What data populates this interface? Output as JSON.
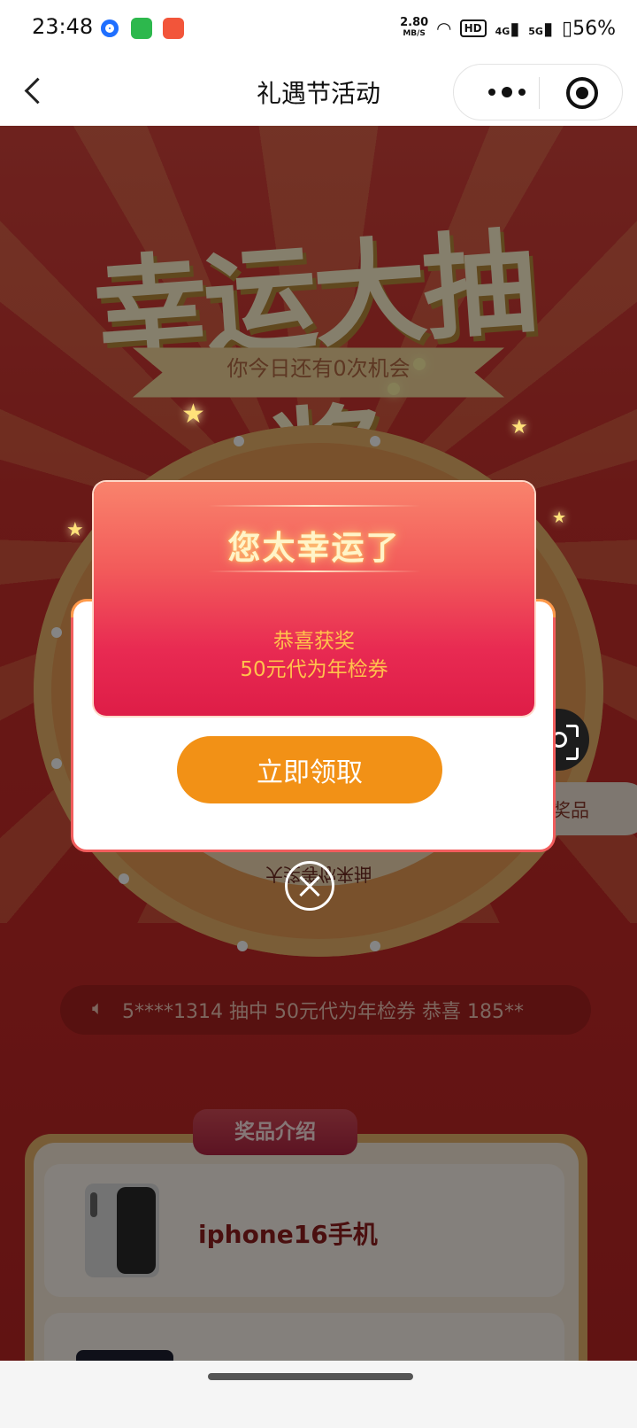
{
  "status_bar": {
    "time": "23:48",
    "net_speed_value": "2.80",
    "net_speed_unit": "MB/S",
    "hd_label": "HD",
    "signal1_label": "4G",
    "signal2_label": "5G",
    "battery": "56%"
  },
  "nav": {
    "title": "礼遇节活动"
  },
  "banner": {
    "title": "幸运大抽奖",
    "chances_text": "你今日还有0次机会"
  },
  "wheel": {
    "under_text": "大奖等你来抽"
  },
  "side_buttons": {
    "my_prizes": "我的奖品"
  },
  "ticker": {
    "text": "5****1314 抽中 50元代为年检券        恭喜 185**"
  },
  "prize_intro": {
    "tag": "奖品介绍",
    "items": [
      {
        "name": "iphone16手机"
      }
    ]
  },
  "modal": {
    "title": "您太幸运了",
    "congrats": "恭喜获奖",
    "prize": "50元代为年检券",
    "claim_button": "立即领取"
  },
  "colors": {
    "page_red": "#c9302c",
    "modal_red": "#e82a52",
    "claim_orange": "#f29116",
    "prize_text_gold": "#ffc24c"
  }
}
